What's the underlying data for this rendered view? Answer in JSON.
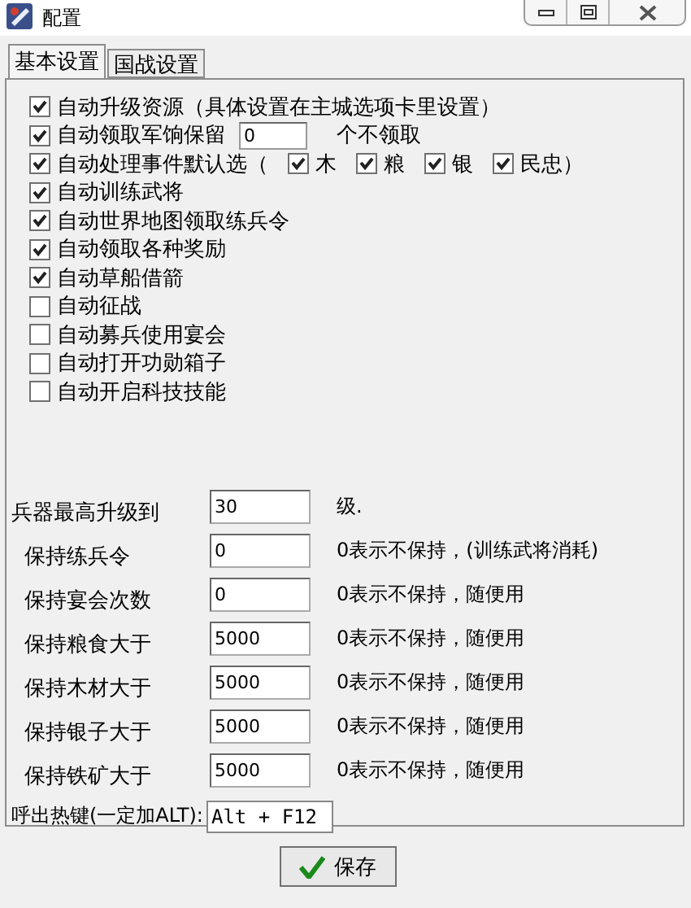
{
  "window": {
    "title": "配置"
  },
  "tabs": [
    {
      "label": "基本设置",
      "selected": true
    },
    {
      "label": "国战设置",
      "selected": false
    }
  ],
  "options": [
    {
      "kind": "plain",
      "label": "自动升级资源（具体设置在主城选项卡里设置）",
      "checked": true
    },
    {
      "kind": "reserve",
      "label": "自动领取军饷保留",
      "checked": true,
      "value": "0",
      "suffix": "个不领取"
    },
    {
      "kind": "choices",
      "label": "自动处理事件默认选（",
      "checked": true,
      "choices": [
        {
          "label": "木",
          "checked": true
        },
        {
          "label": "粮",
          "checked": true
        },
        {
          "label": "银",
          "checked": true
        },
        {
          "label": "民忠）",
          "checked": true
        }
      ]
    },
    {
      "kind": "plain",
      "label": "自动训练武将",
      "checked": true
    },
    {
      "kind": "plain",
      "label": "自动世界地图领取练兵令",
      "checked": true
    },
    {
      "kind": "plain",
      "label": "自动领取各种奖励",
      "checked": true
    },
    {
      "kind": "plain",
      "label": "自动草船借箭",
      "checked": true
    },
    {
      "kind": "plain",
      "label": "自动征战",
      "checked": false
    },
    {
      "kind": "plain",
      "label": "自动募兵使用宴会",
      "checked": false
    },
    {
      "kind": "plain",
      "label": "自动打开功勋箱子",
      "checked": false
    },
    {
      "kind": "plain",
      "label": "自动开启科技技能",
      "checked": false
    }
  ],
  "limits": [
    {
      "kind": "main",
      "label": "兵器最高升级到",
      "value": "30",
      "note": "级."
    },
    {
      "kind": "keep",
      "label": "保持练兵令",
      "value": "0",
      "note": "0表示不保持，(训练武将消耗)"
    },
    {
      "kind": "keep",
      "label": "保持宴会次数",
      "value": "0",
      "note": "0表示不保持，随便用"
    },
    {
      "kind": "keep",
      "label": "保持粮食大于",
      "value": "5000",
      "note": "0表示不保持，随便用"
    },
    {
      "kind": "keep",
      "label": "保持木材大于",
      "value": "5000",
      "note": "0表示不保持，随便用"
    },
    {
      "kind": "keep",
      "label": "保持银子大于",
      "value": "5000",
      "note": "0表示不保持，随便用"
    },
    {
      "kind": "keep",
      "label": "保持铁矿大于",
      "value": "5000",
      "note": "0表示不保持，随便用"
    }
  ],
  "hotkey": {
    "label": "呼出热键(一定加ALT):",
    "value": "Alt + F12"
  },
  "save_button": "保存"
}
